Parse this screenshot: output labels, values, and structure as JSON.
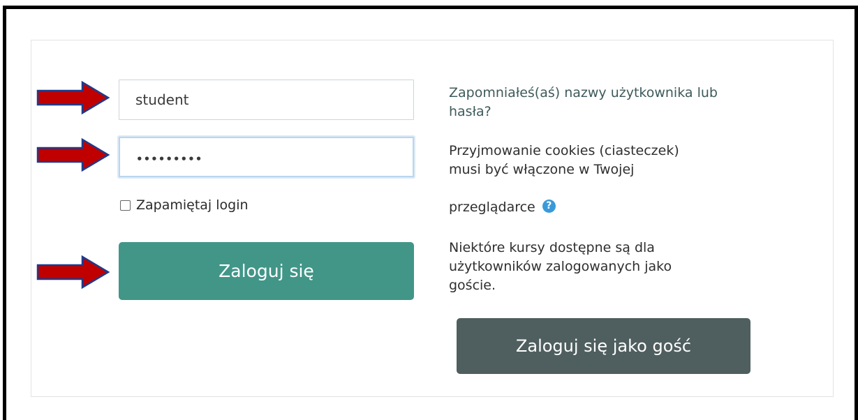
{
  "login_form": {
    "username_value": "student",
    "password_dots": "•••••••••",
    "remember_label": "Zapamiętaj login",
    "login_button": "Zaloguj się"
  },
  "info": {
    "forgot_link": "Zapomniałeś(aś) nazwy użytkownika lub hasła?",
    "cookies_line1": "Przyjmowanie cookies (ciasteczek)",
    "cookies_line2": "musi być włączone w Twojej",
    "cookies_line3": "przeglądarce",
    "help_icon": "?",
    "guest_text": "Niektóre kursy dostępne są dla użytkowników zalogowanych jako goście.",
    "guest_button": "Zaloguj się jako gość"
  },
  "annotations": {
    "arrow_color": "#c00000",
    "arrow_outline": "#1f3a8a"
  }
}
